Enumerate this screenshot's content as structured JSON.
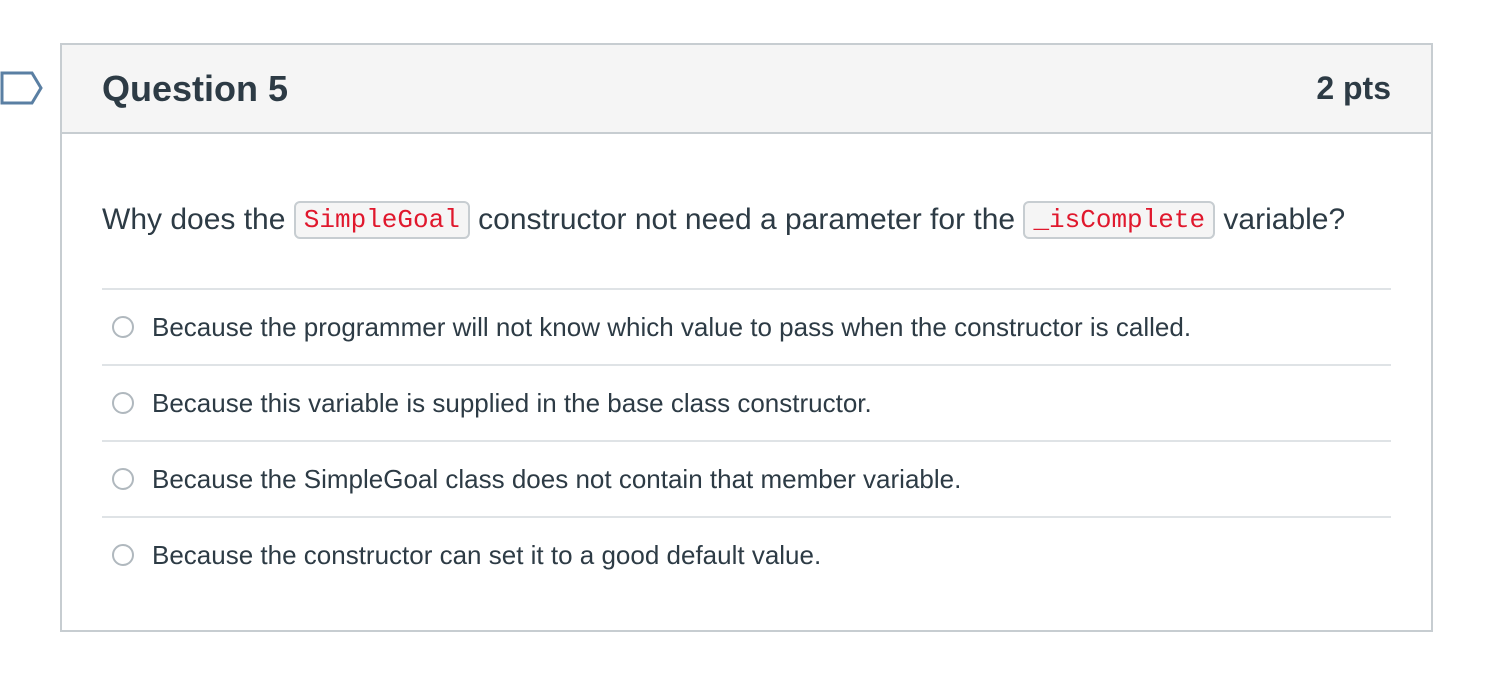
{
  "question": {
    "title": "Question 5",
    "points": "2 pts",
    "text": {
      "part1": "Why does the ",
      "code1": "SimpleGoal",
      "part2": " constructor not need a parameter for the ",
      "code2": "_isComplete",
      "part3": " variable?"
    },
    "answers": [
      {
        "label": "Because the programmer will not know which value to pass when the constructor is called.",
        "selected": false
      },
      {
        "label": "Because this variable is supplied in the base class constructor.",
        "selected": false
      },
      {
        "label": "Because the SimpleGoal class does not contain that member variable.",
        "selected": false
      },
      {
        "label": "Because the constructor can set it to a good default value.",
        "selected": false
      }
    ]
  },
  "colors": {
    "header_bg": "#f5f5f5",
    "border": "#c7cdd1",
    "text": "#2d3b45",
    "code_text": "#e0182d",
    "flag_stroke": "#5a7fa3"
  },
  "icons": {
    "flag": "flag-question-icon",
    "radio": "radio-unchecked-icon"
  }
}
